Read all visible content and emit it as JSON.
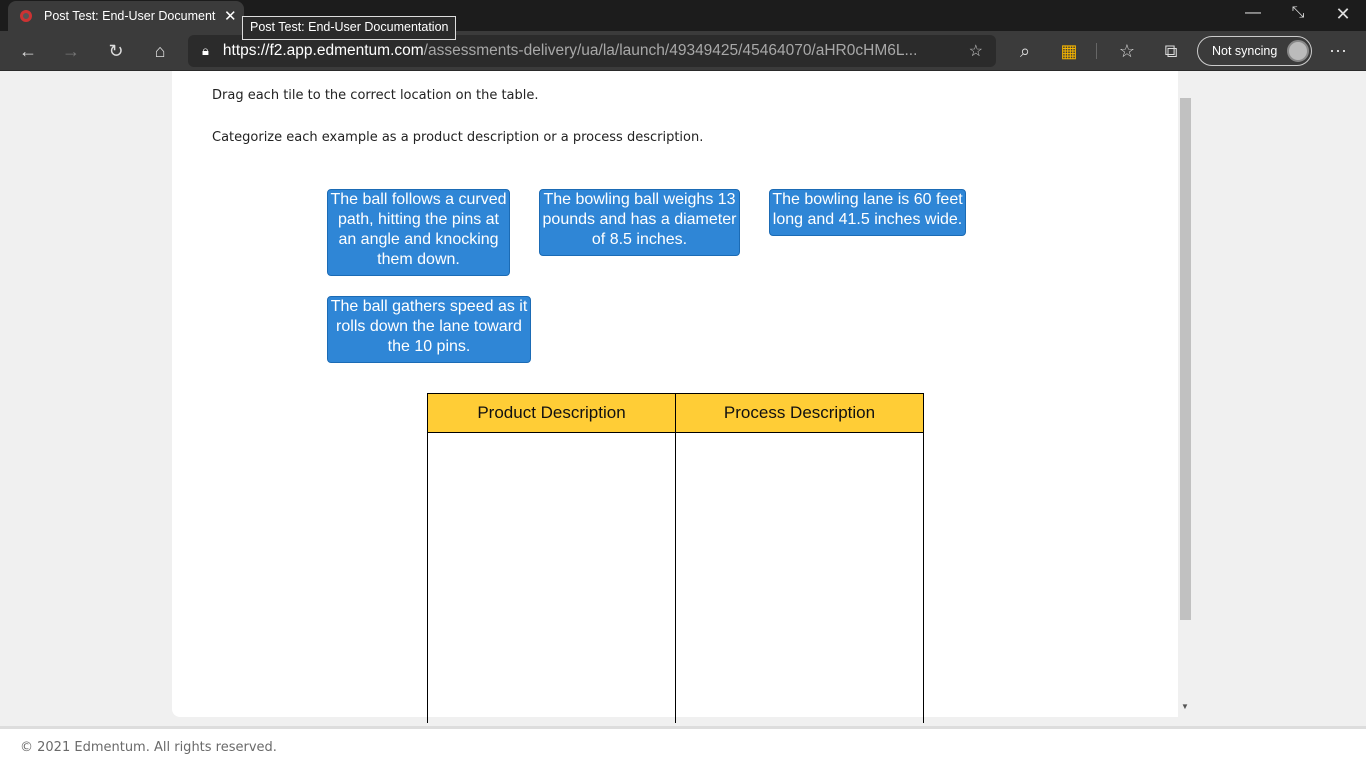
{
  "browser": {
    "tab_title": "Post Test: End-User Documentation",
    "tooltip": "Post Test: End-User Documentation",
    "url_host": "https://f2.app.edmentum.com",
    "url_path": "/assessments-delivery/ua/la/launch/49349425/45464070/aHR0cHM6L...",
    "sync_label": "Not syncing"
  },
  "page": {
    "instruction1": "Drag each tile to the correct location on the table.",
    "instruction2": "Categorize each example as a product description or a process description.",
    "tiles": [
      "The ball follows a curved\npath, hitting the pins at\nan angle and knocking\nthem down.",
      "The bowling ball weighs 13\npounds and has a diameter\nof 8.5 inches.",
      "The bowling lane is 60 feet\nlong and 41.5 inches wide.",
      "The ball gathers speed as it\nrolls down the lane toward\nthe 10 pins."
    ],
    "table": {
      "headers": [
        "Product Description",
        "Process Description"
      ]
    }
  },
  "footer": {
    "copyright": "© 2021 Edmentum. All rights reserved."
  },
  "colors": {
    "tile": "#2f86d6",
    "header": "#ffcd36"
  }
}
